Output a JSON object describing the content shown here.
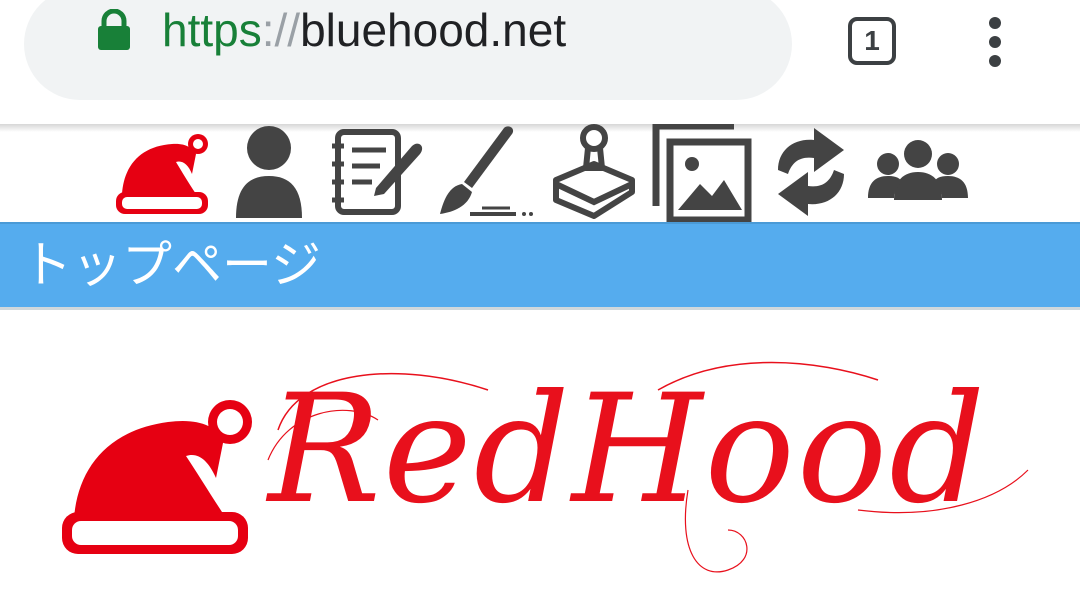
{
  "browser": {
    "url_scheme": "https",
    "url_separator": "://",
    "url_host": "bluehood.net",
    "tab_count": "1",
    "lock_icon": "lock-icon",
    "menu_icon": "more-vert-icon"
  },
  "nav": {
    "icons": [
      "santa-hat-icon",
      "user-icon",
      "notebook-icon",
      "paintbrush-icon",
      "stamp-icon",
      "images-icon",
      "sync-icon",
      "group-icon"
    ]
  },
  "banner": {
    "title": "トップページ",
    "color": "#55acee"
  },
  "logo": {
    "text": "RedHood",
    "color": "#e8101c"
  }
}
